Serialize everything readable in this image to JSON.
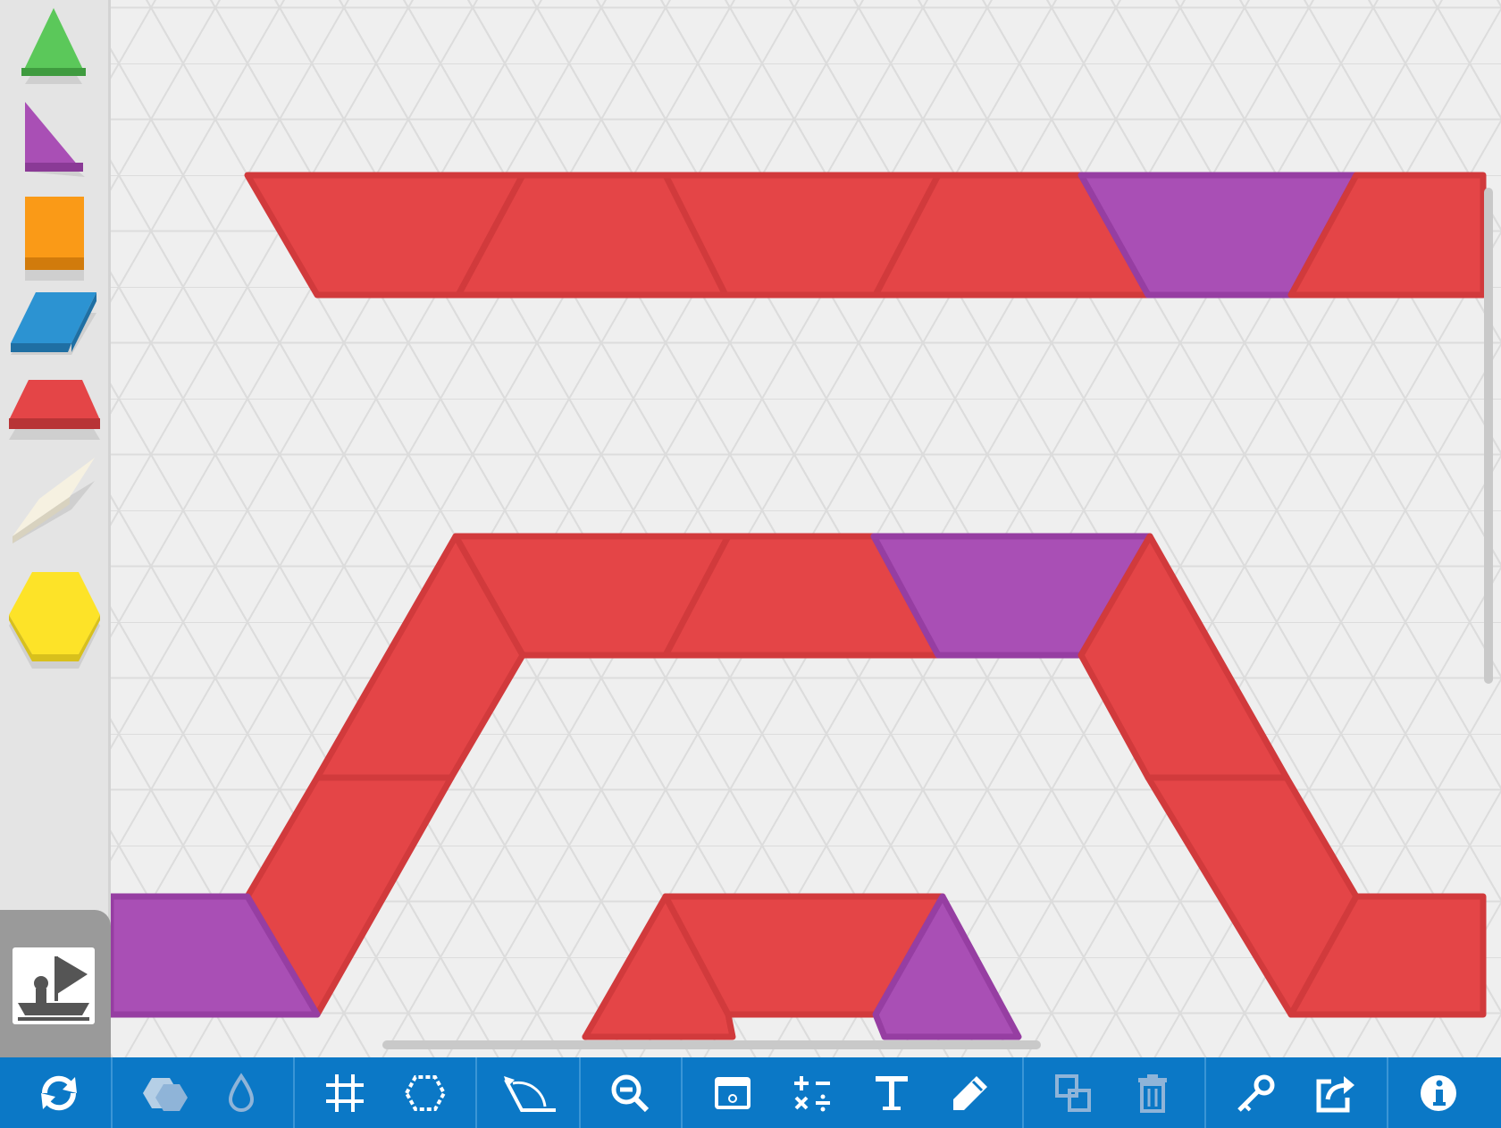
{
  "palette": {
    "items": [
      {
        "name": "triangle",
        "color": "#5bc85a"
      },
      {
        "name": "right-triangle",
        "color": "#a94fb5"
      },
      {
        "name": "square",
        "color": "#fa9a17"
      },
      {
        "name": "blue-rhombus",
        "color": "#2c93d2"
      },
      {
        "name": "trapezoid",
        "color": "#e44547"
      },
      {
        "name": "tan-rhombus",
        "color": "#f6f1e1"
      },
      {
        "name": "hexagon",
        "color": "#fde328"
      }
    ],
    "bookmark_icon": "flag-pin-icon"
  },
  "canvas": {
    "background": "#efefef",
    "grid": "isometric-triangle-grid",
    "piece_colors": {
      "red": "#e44547",
      "purple": "#a94fb5"
    }
  },
  "toolbar": {
    "background": "#0b78c6",
    "tools": [
      "refresh-icon",
      "shapes-icon",
      "color-drop-icon",
      "grid-icon",
      "outline-hexagon-icon",
      "angle-icon",
      "zoom-out-icon",
      "screen-icon",
      "operations-icon",
      "text-icon",
      "pencil-icon",
      "layer-icon",
      "trash-icon",
      "key-icon",
      "share-icon",
      "info-icon"
    ]
  }
}
